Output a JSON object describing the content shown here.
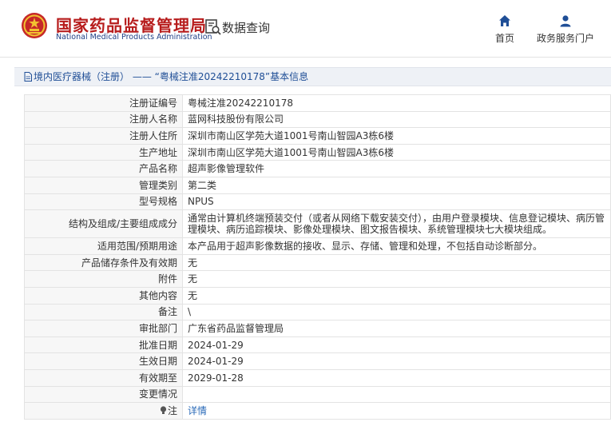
{
  "header": {
    "brand_cn": "国家药品监督管理局",
    "brand_en": "National Medical Products Administration",
    "data_query": "数据查询",
    "nav": {
      "home": "首页",
      "portal": "政务服务门户"
    }
  },
  "breadcrumb": {
    "category": "境内医疗器械（注册）",
    "separator": "——",
    "title": "“粤械注准20242210178”基本信息"
  },
  "details": [
    {
      "label": "注册证编号",
      "value": "粤械注准20242210178"
    },
    {
      "label": "注册人名称",
      "value": "蓝网科技股份有限公司"
    },
    {
      "label": "注册人住所",
      "value": "深圳市南山区学苑大道1001号南山智园A3栋6楼"
    },
    {
      "label": "生产地址",
      "value": "深圳市南山区学苑大道1001号南山智园A3栋6楼"
    },
    {
      "label": "产品名称",
      "value": "超声影像管理软件"
    },
    {
      "label": "管理类别",
      "value": "第二类"
    },
    {
      "label": "型号规格",
      "value": "NPUS"
    },
    {
      "label": "结构及组成/主要组成成分",
      "value": "通常由计算机终端预装交付（或者从网络下载安装交付），由用户登录模块、信息登记模块、病历管理模块、病历追踪模块、影像处理模块、图文报告模块、系统管理模块七大模块组成。"
    },
    {
      "label": "适用范围/预期用途",
      "value": "本产品用于超声影像数据的接收、显示、存储、管理和处理，不包括自动诊断部分。"
    },
    {
      "label": "产品储存条件及有效期",
      "value": "无"
    },
    {
      "label": "附件",
      "value": "无"
    },
    {
      "label": "其他内容",
      "value": "无"
    },
    {
      "label": "备注",
      "value": "\\"
    },
    {
      "label": "审批部门",
      "value": "广东省药品监督管理局"
    },
    {
      "label": "批准日期",
      "value": "2024-01-29"
    },
    {
      "label": "生效日期",
      "value": "2024-01-29"
    },
    {
      "label": "有效期至",
      "value": "2029-01-28"
    },
    {
      "label": "变更情况",
      "value": ""
    }
  ],
  "note": {
    "label": "注",
    "link": "详情"
  },
  "colors": {
    "brand_red": "#b71c1c",
    "brand_blue": "#1f3f86",
    "link_blue": "#2a6ab8",
    "crumb_bg": "#eef1f6"
  }
}
